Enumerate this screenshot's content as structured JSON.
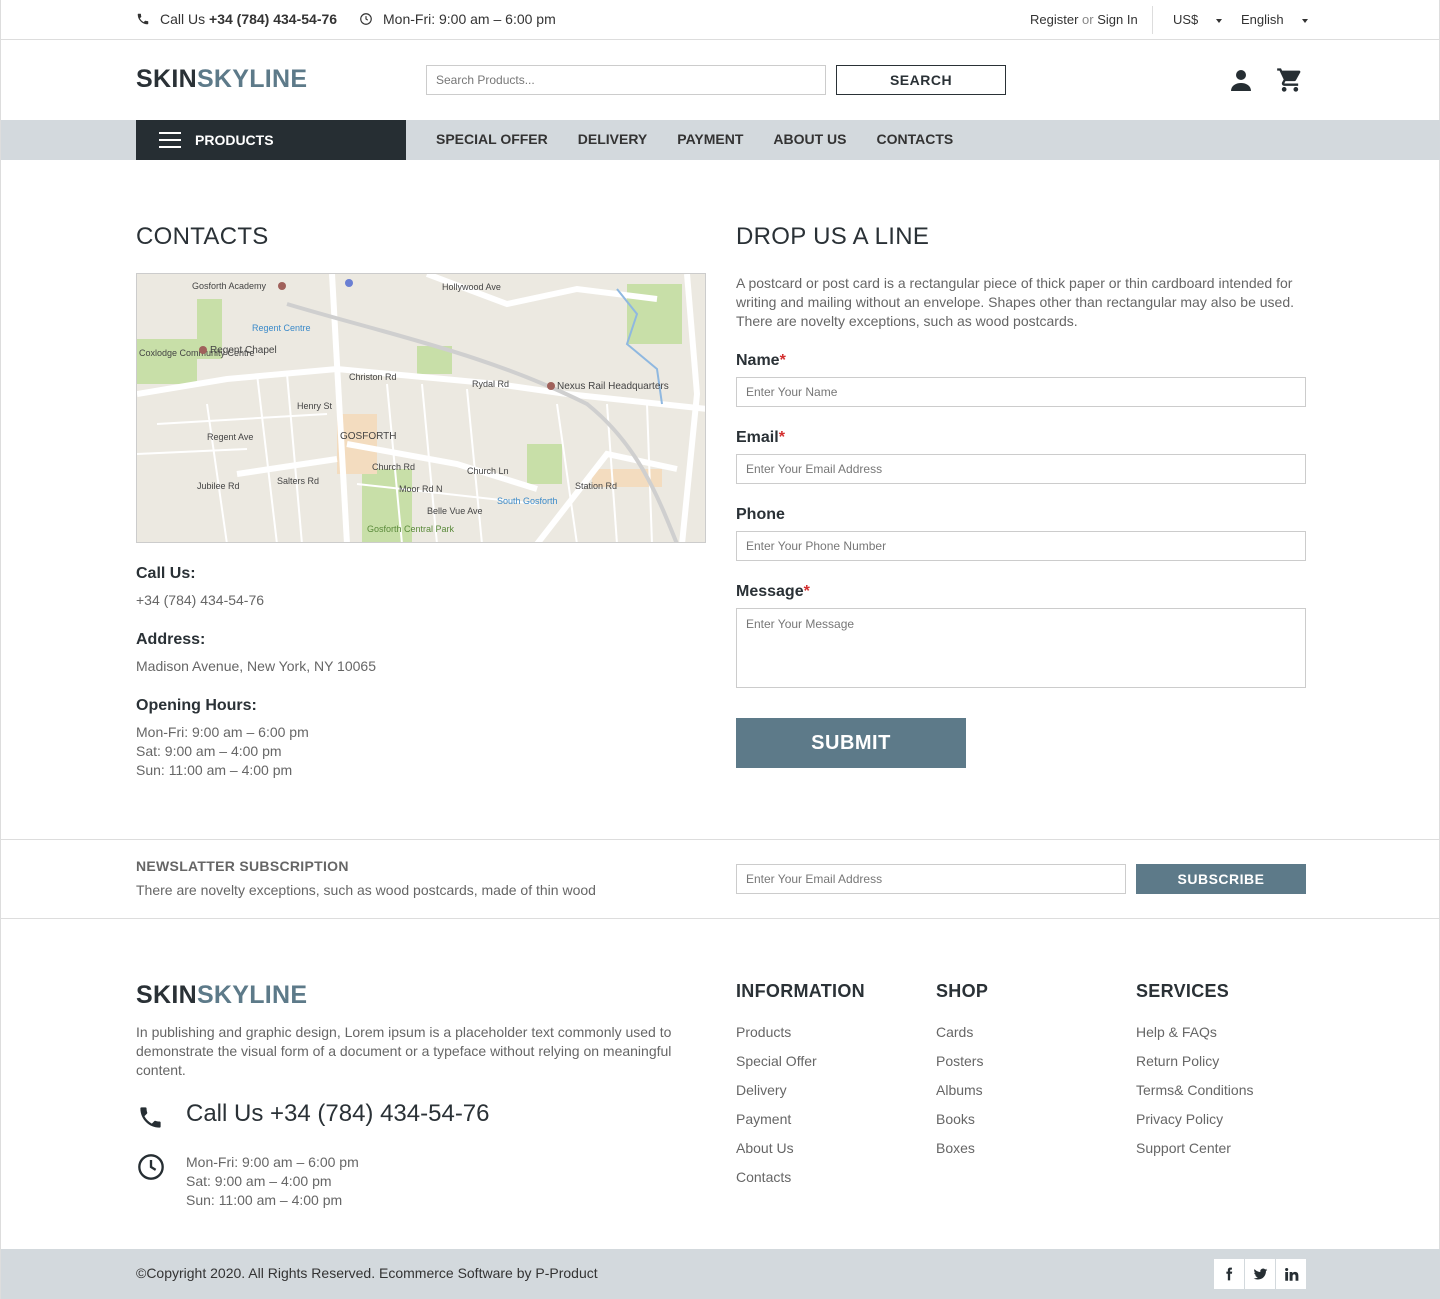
{
  "topbar": {
    "call_prefix": "Call Us",
    "phone": "+34 (784) 434-54-76",
    "hours": "Mon-Fri: 9:00 am – 6:00 pm",
    "register": "Register",
    "or": "or",
    "signin": "Sign In",
    "currency": "US$",
    "language": "English"
  },
  "header": {
    "logo_part1": "SKIN",
    "logo_part2": "SKYLINE",
    "search_placeholder": "Search Products...",
    "search_button": "SEARCH"
  },
  "nav": {
    "products": "PRODUCTS",
    "links": [
      "SPECIAL OFFER",
      "DELIVERY",
      "PAYMENT",
      "ABOUT US",
      "CONTACTS"
    ]
  },
  "contacts": {
    "title": "CONTACTS",
    "map_labels": [
      "Gosforth Academy",
      "Hollywood Ave",
      "Regent Centre",
      "Regent Chapel",
      "Coxlodge Community Centre",
      "Christon Rd",
      "Rydal Rd",
      "Nexus Rail Headquarters",
      "Henry St",
      "GOSFORTH",
      "Regent Ave",
      "Church Rd",
      "Salters Rd",
      "South Gosforth",
      "Station Rd",
      "Gosforth Central Park",
      "Moor Rd N",
      "Belle Vue Ave",
      "Jubilee Rd",
      "Church Ln"
    ],
    "call_label": "Call Us:",
    "call_value": "+34 (784) 434-54-76",
    "address_label": "Address:",
    "address_value": "Madison Avenue, New York, NY 10065",
    "hours_label": "Opening Hours:",
    "hours": [
      "Mon-Fri: 9:00 am – 6:00 pm",
      "Sat: 9:00 am – 4:00 pm",
      "Sun: 11:00 am – 4:00 pm"
    ]
  },
  "form": {
    "title": "DROP US A LINE",
    "intro": "A postcard or post card is a rectangular piece of thick paper or thin cardboard intended for writing and mailing without an envelope. Shapes other than rectangular may also be used. There are novelty exceptions, such as wood postcards.",
    "name_label": "Name",
    "name_placeholder": "Enter Your Name",
    "email_label": "Email",
    "email_placeholder": "Enter Your Email Address",
    "phone_label": "Phone",
    "phone_placeholder": "Enter Your Phone Number",
    "message_label": "Message",
    "message_placeholder": "Enter Your Message",
    "required_mark": "*",
    "submit": "SUBMIT"
  },
  "newsletter": {
    "title": "NEWSLATTER SUBSCRIPTION",
    "text": "There are novelty exceptions, such as wood postcards, made of thin wood",
    "placeholder": "Enter Your Email Address",
    "button": "SUBSCRIBE"
  },
  "footer": {
    "description": "In publishing and graphic design, Lorem ipsum is a placeholder text commonly used to demonstrate the visual form of a document or a typeface without relying on meaningful content.",
    "phone": "Call Us +34 (784) 434-54-76",
    "hours": [
      "Mon-Fri: 9:00 am – 6:00 pm",
      "Sat: 9:00 am – 4:00 pm",
      "Sun: 11:00 am – 4:00 pm"
    ],
    "columns": [
      {
        "title": "INFORMATION",
        "links": [
          "Products",
          "Special Offer",
          "Delivery",
          "Payment",
          "About Us",
          "Contacts"
        ]
      },
      {
        "title": "SHOP",
        "links": [
          "Cards",
          "Posters",
          "Albums",
          "Books",
          "Boxes"
        ]
      },
      {
        "title": "SERVICES",
        "links": [
          "Help & FAQs",
          "Return Policy",
          "Terms& Conditions",
          "Privacy Policy",
          "Support Center"
        ]
      }
    ],
    "copyright": "©Copyright 2020. All Rights Reserved. Ecommerce Software by P-Product",
    "social": [
      "facebook-icon",
      "twitter-icon",
      "linkedin-icon"
    ]
  },
  "colors": {
    "dark": "#262e33",
    "accent": "#5d7a89",
    "nav_bg": "#d3d9dd",
    "required": "#d32f2f"
  }
}
